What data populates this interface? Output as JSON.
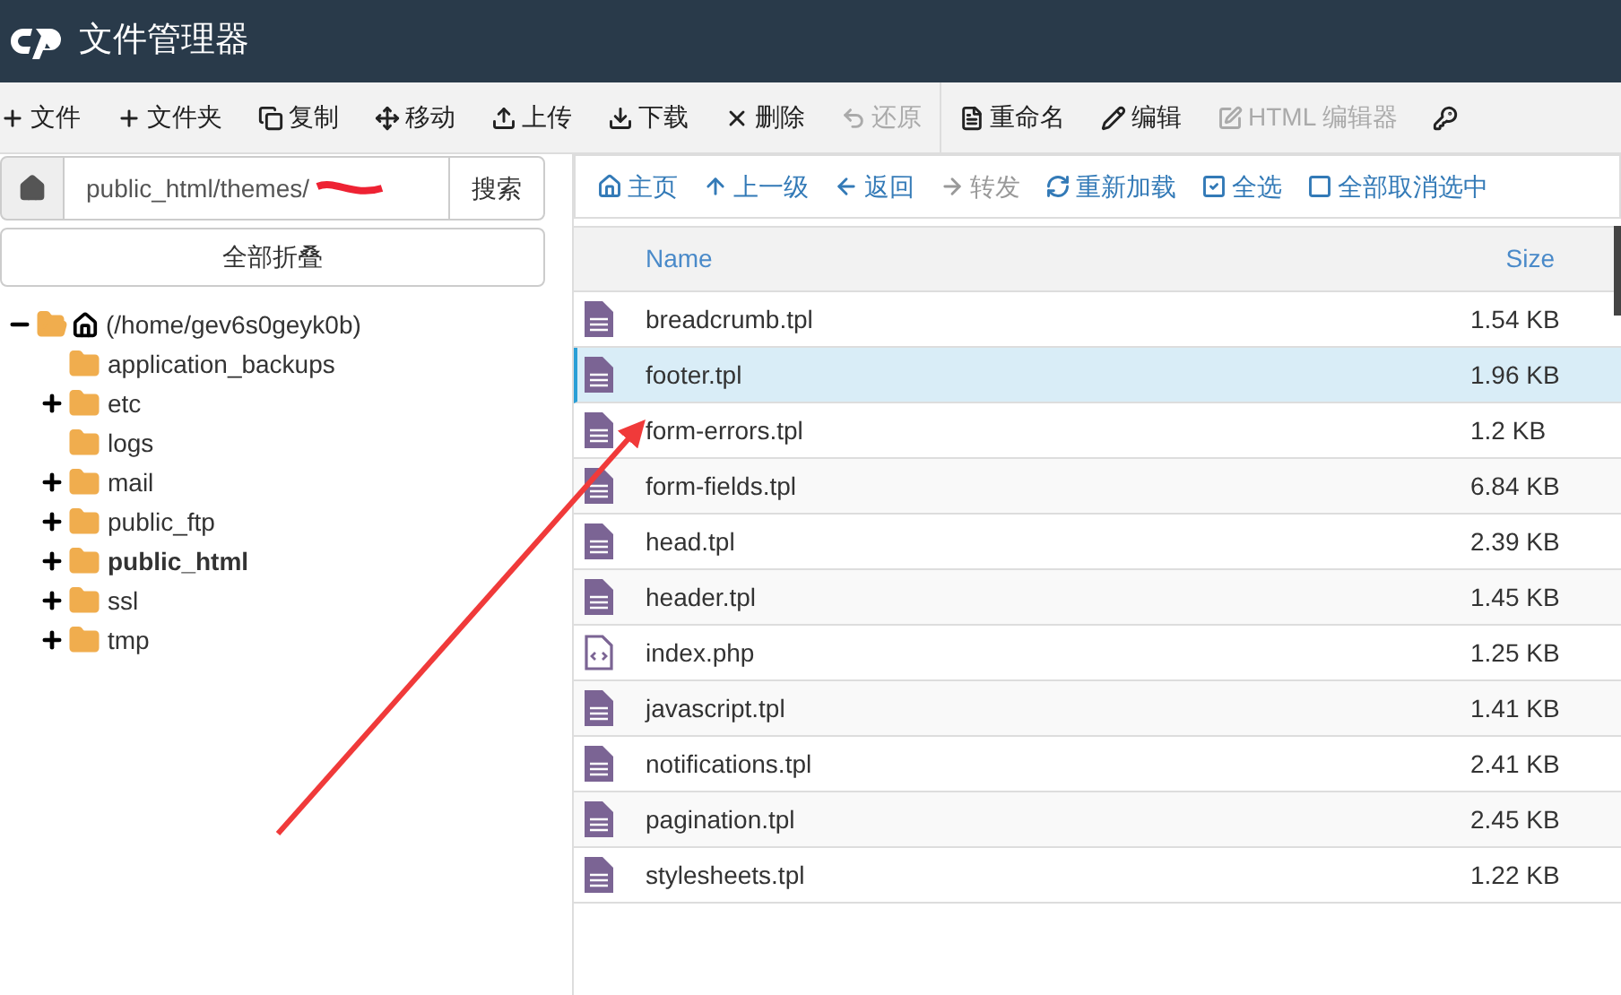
{
  "header": {
    "title": "文件管理器"
  },
  "toolbar": [
    {
      "label": "文件",
      "disabled": false
    },
    {
      "label": "文件夹",
      "disabled": false
    },
    {
      "label": "复制",
      "disabled": false
    },
    {
      "label": "移动",
      "disabled": false
    },
    {
      "label": "上传",
      "disabled": false
    },
    {
      "label": "下载",
      "disabled": false
    },
    {
      "label": "删除",
      "disabled": false
    },
    {
      "label": "还原",
      "disabled": true
    },
    {
      "label": "重命名",
      "disabled": false
    },
    {
      "label": "编辑",
      "disabled": false
    },
    {
      "label": "HTML 编辑器",
      "disabled": true
    },
    {
      "disabled": false
    }
  ],
  "path": {
    "value": "public_html/themes/",
    "search_button": "搜索"
  },
  "collapse_all": "全部折叠",
  "tree": [
    {
      "label": "(/home/gev6s0geyk0b)",
      "expandable": true,
      "expanded": true,
      "selected": false,
      "children": [
        {
          "label": "application_backups",
          "expandable": false,
          "expanded": false,
          "selected": false
        },
        {
          "label": "etc",
          "expandable": true,
          "expanded": false,
          "selected": false
        },
        {
          "label": "logs",
          "expandable": false,
          "expanded": false,
          "selected": false
        },
        {
          "label": "mail",
          "expandable": true,
          "expanded": false,
          "selected": false
        },
        {
          "label": "public_ftp",
          "expandable": true,
          "expanded": false,
          "selected": false
        },
        {
          "label": "public_html",
          "expandable": true,
          "expanded": false,
          "selected": true
        },
        {
          "label": "ssl",
          "expandable": true,
          "expanded": false,
          "selected": false
        },
        {
          "label": "tmp",
          "expandable": true,
          "expanded": false,
          "selected": false
        }
      ]
    }
  ],
  "nav": [
    {
      "label": "主页",
      "disabled": false
    },
    {
      "label": "上一级",
      "disabled": false
    },
    {
      "label": "返回",
      "disabled": false
    },
    {
      "label": "转发",
      "disabled": true
    },
    {
      "label": "重新加载",
      "disabled": false
    },
    {
      "label": "全选",
      "disabled": false
    },
    {
      "label": "全部取消选中",
      "disabled": false
    }
  ],
  "table": {
    "columns": [
      "Name",
      "Size"
    ],
    "rows": [
      {
        "kind": "text",
        "name": "breadcrumb.tpl",
        "size": "1.54 KB",
        "selected": false
      },
      {
        "kind": "text",
        "name": "footer.tpl",
        "size": "1.96 KB",
        "selected": true
      },
      {
        "kind": "text",
        "name": "form-errors.tpl",
        "size": "1.2 KB",
        "selected": false
      },
      {
        "kind": "text",
        "name": "form-fields.tpl",
        "size": "6.84 KB",
        "selected": false
      },
      {
        "kind": "text",
        "name": "head.tpl",
        "size": "2.39 KB",
        "selected": false
      },
      {
        "kind": "text",
        "name": "header.tpl",
        "size": "1.45 KB",
        "selected": false
      },
      {
        "kind": "code",
        "name": "index.php",
        "size": "1.25 KB",
        "selected": false
      },
      {
        "kind": "text",
        "name": "javascript.tpl",
        "size": "1.41 KB",
        "selected": false
      },
      {
        "kind": "text",
        "name": "notifications.tpl",
        "size": "2.41 KB",
        "selected": false
      },
      {
        "kind": "text",
        "name": "pagination.tpl",
        "size": "2.45 KB",
        "selected": false
      },
      {
        "kind": "text",
        "name": "stylesheets.tpl",
        "size": "1.22 KB",
        "selected": false
      }
    ]
  }
}
